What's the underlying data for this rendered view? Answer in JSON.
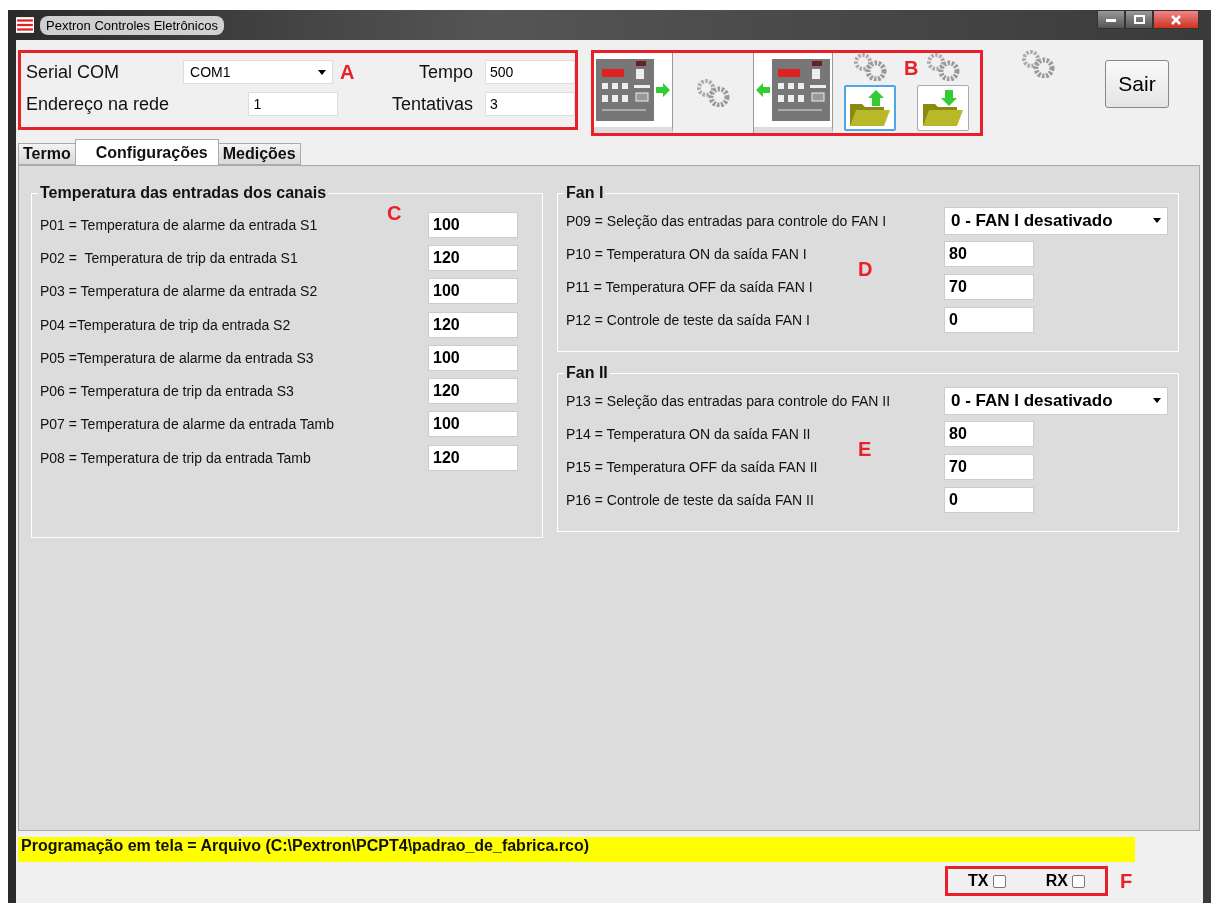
{
  "window": {
    "title": "Pextron Controles Eletrônicos"
  },
  "connection": {
    "marker": "A",
    "serial_label": "Serial COM",
    "serial_value": "COM1",
    "address_label": "Endereço na rede",
    "address_value": "1",
    "time_label": "Tempo",
    "time_value": "500",
    "retries_label": "Tentativas",
    "retries_value": "3"
  },
  "toolbar": {
    "marker": "B",
    "buttons": [
      {
        "kind": "device_send"
      },
      {
        "kind": "gears"
      },
      {
        "kind": "device_receive"
      },
      {
        "kind": "folder_upload",
        "focused": true
      },
      {
        "kind": "folder_download",
        "focused": false
      }
    ]
  },
  "exit_button": "Sair",
  "tabs": [
    {
      "label": "Termo",
      "selected": false
    },
    {
      "label": "Configurações",
      "selected": true
    },
    {
      "label": "Medições",
      "selected": false
    }
  ],
  "temperature_group": {
    "title": "Temperatura das entradas dos canais",
    "marker": "C",
    "params": [
      {
        "label": "P01 = Temperatura de alarme da entrada S1",
        "value": "100"
      },
      {
        "label": "P02 =  Temperatura de trip da entrada S1",
        "value": "120"
      },
      {
        "label": "P03 = Temperatura de alarme da entrada S2",
        "value": "100"
      },
      {
        "label": "P04 =Temperatura de trip da entrada S2",
        "value": "120"
      },
      {
        "label": "P05 =Temperatura de alarme da entrada S3",
        "value": "100"
      },
      {
        "label": "P06 = Temperatura de trip da entrada S3",
        "value": "120"
      },
      {
        "label": "P07 = Temperatura de alarme da entrada Tamb",
        "value": "100"
      },
      {
        "label": "P08 = Temperatura de trip da entrada Tamb",
        "value": "120"
      }
    ]
  },
  "fan_groups": [
    {
      "title": "Fan I",
      "marker": "D",
      "params": [
        {
          "kind": "select",
          "label": "P09 = Seleção das entradas para controle do FAN I",
          "value": "0 - FAN I desativado"
        },
        {
          "kind": "input",
          "label": "P10 = Temperatura ON da saída FAN I",
          "value": "80"
        },
        {
          "kind": "input",
          "label": "P11 = Temperatura OFF da saída FAN I",
          "value": "70"
        },
        {
          "kind": "input",
          "label": "P12 = Controle de teste da saída FAN I",
          "value": "0"
        }
      ]
    },
    {
      "title": "Fan II",
      "marker": "E",
      "params": [
        {
          "kind": "select",
          "label": "P13 = Seleção das entradas para controle do FAN II",
          "value": "0 - FAN I desativado"
        },
        {
          "kind": "input",
          "label": "P14 = Temperatura ON da saída FAN II",
          "value": "80"
        },
        {
          "kind": "input",
          "label": "P15 = Temperatura OFF da saída FAN II",
          "value": "70"
        },
        {
          "kind": "input",
          "label": "P16 = Controle de teste da saída FAN II",
          "value": "0"
        }
      ]
    }
  ],
  "status": {
    "text": "Programação em tela = Arquivo (C:\\Pextron\\PCPT4\\padrao_de_fabrica.rco)",
    "marker": "F",
    "indicators": [
      {
        "label": "TX",
        "checked": false
      },
      {
        "label": "RX",
        "checked": false
      }
    ]
  }
}
